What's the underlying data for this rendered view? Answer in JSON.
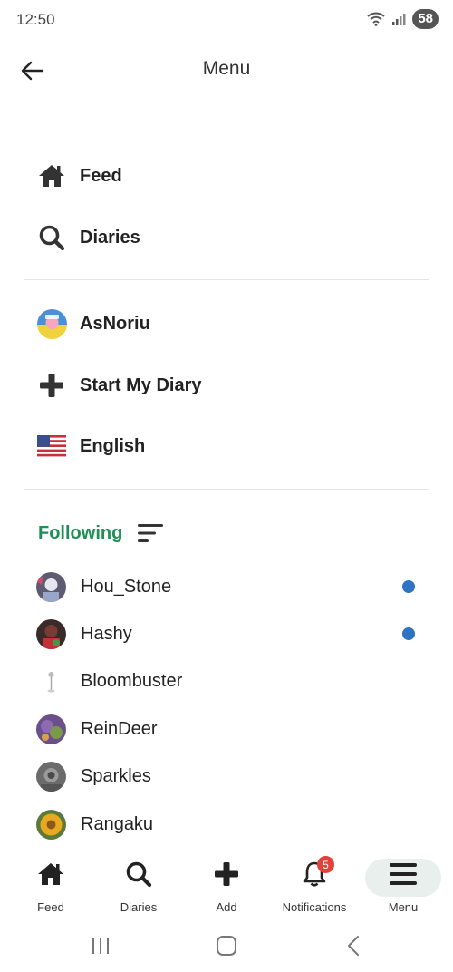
{
  "status_bar": {
    "time": "12:50",
    "battery": "58"
  },
  "header": {
    "title": "Menu"
  },
  "nav_section": [
    {
      "label": "Feed",
      "icon": "home-icon"
    },
    {
      "label": "Diaries",
      "icon": "search-icon"
    }
  ],
  "account_section": [
    {
      "label": "AsNoriu",
      "icon": "avatar"
    },
    {
      "label": "Start My Diary",
      "icon": "plus-icon"
    },
    {
      "label": "English",
      "icon": "us-flag-icon"
    }
  ],
  "following": {
    "label": "Following",
    "items": [
      {
        "name": "Hou_Stone",
        "unread": true
      },
      {
        "name": "Hashy",
        "unread": true
      },
      {
        "name": "Bloombuster",
        "unread": false
      },
      {
        "name": "ReinDeer",
        "unread": false
      },
      {
        "name": "Sparkles",
        "unread": false
      },
      {
        "name": "Rangaku",
        "unread": false
      }
    ]
  },
  "bottom_nav": {
    "feed": "Feed",
    "diaries": "Diaries",
    "add": "Add",
    "notifications": "Notifications",
    "notifications_count": "5",
    "menu": "Menu"
  },
  "colors": {
    "accent": "#1f8e57",
    "unread_dot": "#2f74c0",
    "badge": "#e0433a",
    "active_pill": "#e9efec"
  }
}
